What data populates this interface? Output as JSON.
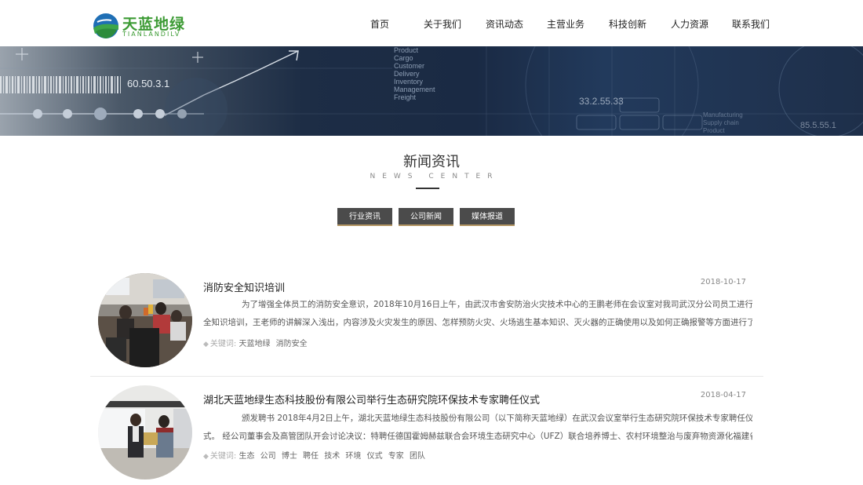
{
  "logo": {
    "cn": "天蓝地绿",
    "en": "TIANLANDILV"
  },
  "nav": [
    "首页",
    "关于我们",
    "资讯动态",
    "主营业务",
    "科技创新",
    "人力资源",
    "联系我们"
  ],
  "banner": {
    "number_left": "60.50.3.1",
    "number_right": "33.2.55.33",
    "words": [
      "Product",
      "Cargo",
      "Customer",
      "Delivery",
      "Inventory",
      "Management",
      "Freight"
    ],
    "words_right": [
      "Manufacturing",
      "Supply chain",
      "Product"
    ],
    "number_far_right": "85.5.55.1"
  },
  "section": {
    "title": "新闻资讯",
    "subtitle": "NEWS CENTER"
  },
  "tabs": [
    "行业资讯",
    "公司新闻",
    "媒体报道"
  ],
  "news": [
    {
      "title": "消防安全知识培训",
      "date": "2018-10-17",
      "desc_line1": "为了增强全体员工的消防安全意识，2018年10月16日上午，由武汉市舍安防治火灾技术中心的王鹏老师在会议室对我司武汉分公司员工进行消防安",
      "desc_line2": "全知识培训，王老师的讲解深入浅出，内容涉及火灾发生的原因、怎样预防火灾、火场逃生基本知识、灭火器的正确使用以及如何正确报警等方面进行了生动...",
      "tags_label": "关键词:",
      "tags": [
        "天蓝地绿",
        "消防安全"
      ]
    },
    {
      "title": "湖北天蓝地绿生态科技股份有限公司举行生态研究院环保技术专家聘任仪式",
      "date": "2018-04-17",
      "desc_line1": "颁发聘书  2018年4月2日上午，湖北天蓝地绿生态科技股份有限公司（以下简称天蓝地绿）在武汉会议室举行生态研究院环保技术专家聘任仪",
      "desc_line2": "式。  经公司董事会及高管团队开会讨论决议：特聘任德国霍姆赫兹联合会环境生态研究中心（UFZ）联合培养博士、农村环境整治与废弃物资源化福建省高校...",
      "tags_label": "关键词:",
      "tags": [
        "生态",
        "公司",
        "博士",
        "聘任",
        "技术",
        "环境",
        "仪式",
        "专家",
        "团队"
      ]
    }
  ]
}
